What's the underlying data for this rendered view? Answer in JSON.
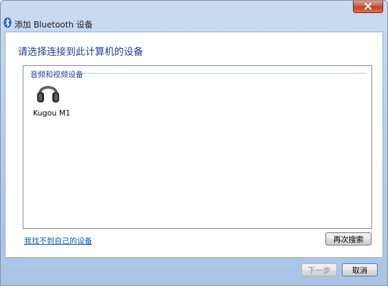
{
  "window": {
    "title": "添加 Bluetooth 设备",
    "close_icon": "close-icon"
  },
  "main": {
    "heading": "请选择连接到此计算机的设备",
    "group_label": "音频和视频设备",
    "devices": [
      {
        "name": "Kugou M1",
        "icon": "headphones-icon"
      }
    ],
    "help_link": "我找不到自己的设备",
    "search_again_label": "再次搜索"
  },
  "footer": {
    "next_label": "下一步",
    "next_enabled": false,
    "cancel_label": "取消"
  },
  "colors": {
    "heading": "#1e3f8f",
    "link": "#0a5db0",
    "close_button": "#c2432c"
  }
}
